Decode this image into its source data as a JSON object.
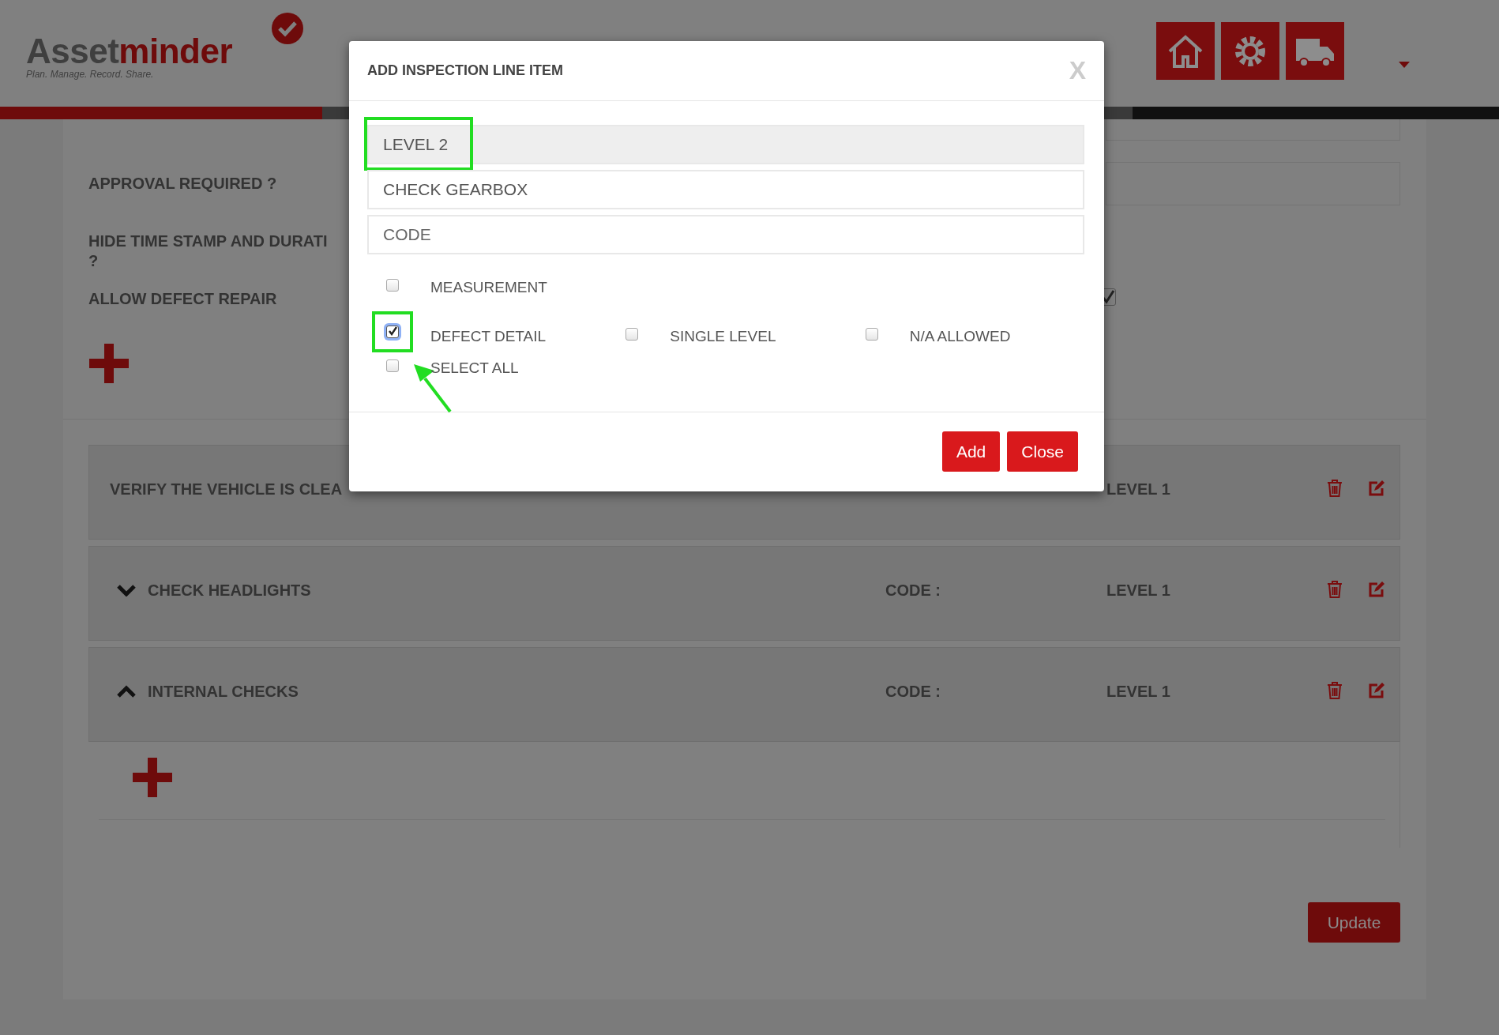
{
  "header": {
    "logo": {
      "parts": [
        {
          "text": "Asset",
          "color": "#3f3f3f"
        },
        {
          "text": "minder",
          "color": "#6e0b0b"
        }
      ],
      "tagline": "Plan. Manage. Record. Share."
    }
  },
  "settings": [
    {
      "kind": "input",
      "lines": [
        "APPROVAL REQUIRED ?"
      ]
    },
    {
      "kind": "none",
      "lines": [
        "HIDE TIME STAMP AND DURATI",
        "?"
      ]
    },
    {
      "kind": "checkbox",
      "lines": [
        "ALLOW DEFECT REPAIR"
      ],
      "checked": true
    }
  ],
  "line_items": [
    {
      "kind": "item",
      "title": "VERIFY THE VEHICLE IS CLEA",
      "level": "LEVEL 1"
    },
    {
      "kind": "group",
      "expanded": false,
      "title": "CHECK HEADLIGHTS",
      "code": "CODE :",
      "level": "LEVEL 1"
    },
    {
      "kind": "group",
      "expanded": true,
      "title": "INTERNAL CHECKS",
      "code": "CODE :",
      "level": "LEVEL 1"
    }
  ],
  "update_button": "Update",
  "modal": {
    "title": "ADD INSPECTION LINE ITEM",
    "close": "X",
    "fields": [
      {
        "value": "LEVEL 2",
        "disabled": true,
        "highlighted": true
      },
      {
        "value": "CHECK GEARBOX",
        "disabled": false,
        "highlighted": false
      },
      {
        "placeholder": "CODE",
        "disabled": false,
        "highlighted": false
      }
    ],
    "option_rows": [
      [
        {
          "label": "MEASUREMENT",
          "checked": false,
          "highlighted": false
        }
      ],
      [
        {
          "label": "DEFECT DETAIL",
          "checked": true,
          "highlighted": true
        },
        {
          "label": "SINGLE LEVEL",
          "checked": false,
          "highlighted": false
        },
        {
          "label": "N/A ALLOWED",
          "checked": false,
          "highlighted": false
        }
      ],
      [
        {
          "label": "SELECT ALL",
          "checked": false,
          "highlighted": false
        }
      ]
    ],
    "buttons": [
      "Add",
      "Close"
    ]
  }
}
